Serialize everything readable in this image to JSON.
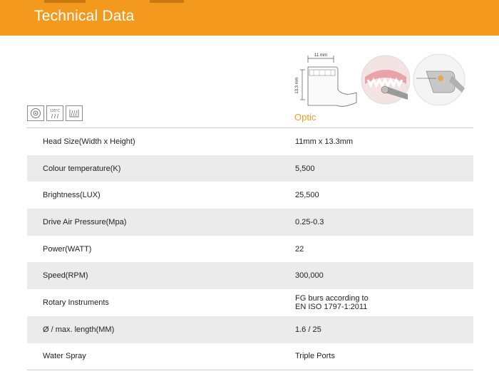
{
  "header": {
    "title": "Technical Data",
    "background": "#f39a1e"
  },
  "product": {
    "variant_label": "Optic",
    "dimension_width": "11 mm",
    "dimension_height": "13.3 mm",
    "icon_badges": [
      "thermo-disinfector-icon",
      "sterilize-135-icon",
      "steam-icon"
    ],
    "sterilize_temp": "135°C"
  },
  "specs": [
    {
      "label": "Head Size(Width x Height)",
      "value": "11mm x 13.3mm"
    },
    {
      "label": "Colour temperature(K)",
      "value": "5,500"
    },
    {
      "label": "Brightness(LUX)",
      "value": "25,500"
    },
    {
      "label": "Drive Air Pressure(Mpa)",
      "value": "0.25-0.3"
    },
    {
      "label": "Power(WATT)",
      "value": "22"
    },
    {
      "label": "Speed(RPM)",
      "value": "300,000"
    },
    {
      "label": "Rotary Instruments",
      "value": "FG burs according to",
      "value2": "EN ISO 1797-1:2011"
    },
    {
      "label": "Ø / max. length(MM)",
      "value": "1.6 / 25"
    },
    {
      "label": "Water Spray",
      "value": "Triple Ports"
    }
  ]
}
